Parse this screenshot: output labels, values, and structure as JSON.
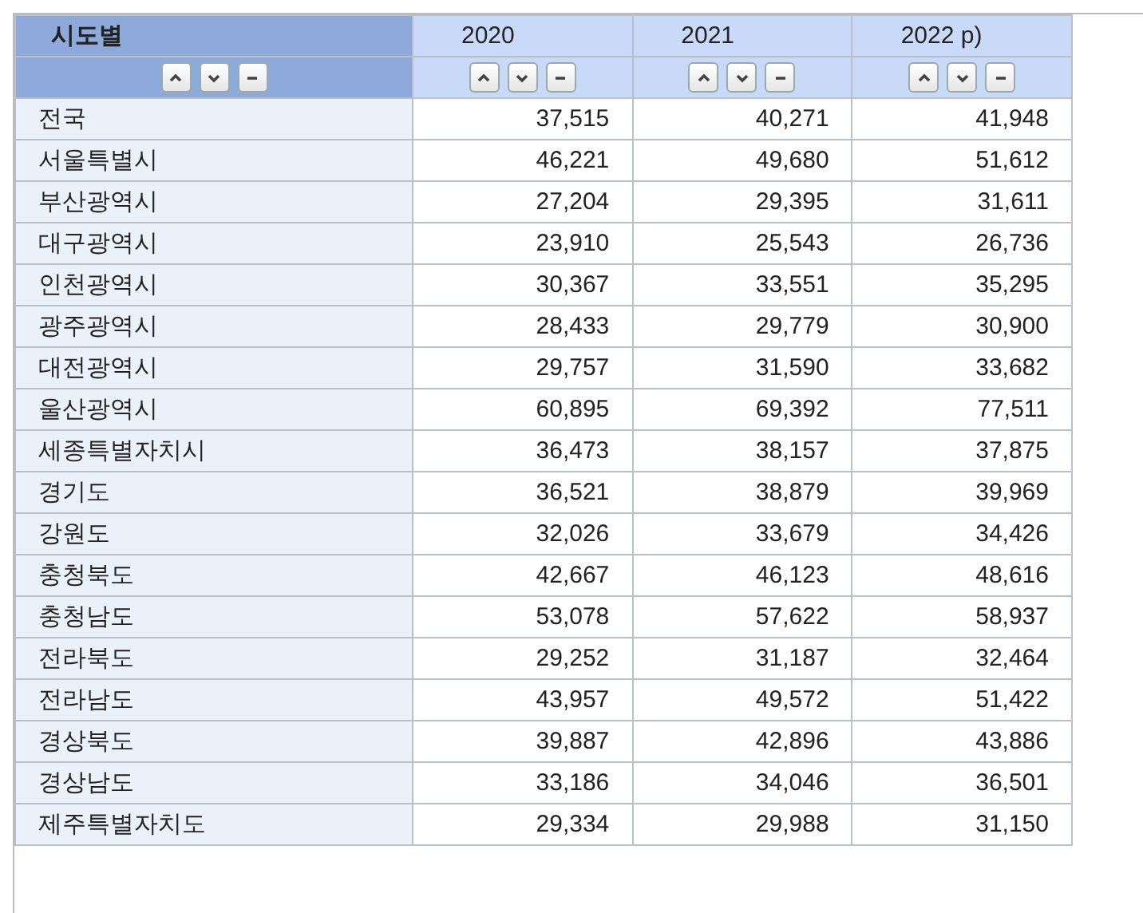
{
  "table": {
    "columns": [
      {
        "label": "시도별",
        "kind": "row_header"
      },
      {
        "label": "2020",
        "kind": "value"
      },
      {
        "label": "2021",
        "kind": "value"
      },
      {
        "label": "2022 p)",
        "kind": "value"
      }
    ],
    "rows": [
      {
        "region": "전국",
        "values": [
          "37,515",
          "40,271",
          "41,948"
        ]
      },
      {
        "region": "서울특별시",
        "values": [
          "46,221",
          "49,680",
          "51,612"
        ]
      },
      {
        "region": "부산광역시",
        "values": [
          "27,204",
          "29,395",
          "31,611"
        ]
      },
      {
        "region": "대구광역시",
        "values": [
          "23,910",
          "25,543",
          "26,736"
        ]
      },
      {
        "region": "인천광역시",
        "values": [
          "30,367",
          "33,551",
          "35,295"
        ]
      },
      {
        "region": "광주광역시",
        "values": [
          "28,433",
          "29,779",
          "30,900"
        ]
      },
      {
        "region": "대전광역시",
        "values": [
          "29,757",
          "31,590",
          "33,682"
        ]
      },
      {
        "region": "울산광역시",
        "values": [
          "60,895",
          "69,392",
          "77,511"
        ]
      },
      {
        "region": "세종특별자치시",
        "values": [
          "36,473",
          "38,157",
          "37,875"
        ]
      },
      {
        "region": "경기도",
        "values": [
          "36,521",
          "38,879",
          "39,969"
        ]
      },
      {
        "region": "강원도",
        "values": [
          "32,026",
          "33,679",
          "34,426"
        ]
      },
      {
        "region": "충청북도",
        "values": [
          "42,667",
          "46,123",
          "48,616"
        ]
      },
      {
        "region": "충청남도",
        "values": [
          "53,078",
          "57,622",
          "58,937"
        ]
      },
      {
        "region": "전라북도",
        "values": [
          "29,252",
          "31,187",
          "32,464"
        ]
      },
      {
        "region": "전라남도",
        "values": [
          "43,957",
          "49,572",
          "51,422"
        ]
      },
      {
        "region": "경상북도",
        "values": [
          "39,887",
          "42,896",
          "43,886"
        ]
      },
      {
        "region": "경상남도",
        "values": [
          "33,186",
          "34,046",
          "36,501"
        ]
      },
      {
        "region": "제주특별자치도",
        "values": [
          "29,334",
          "29,988",
          "31,150"
        ]
      }
    ]
  }
}
